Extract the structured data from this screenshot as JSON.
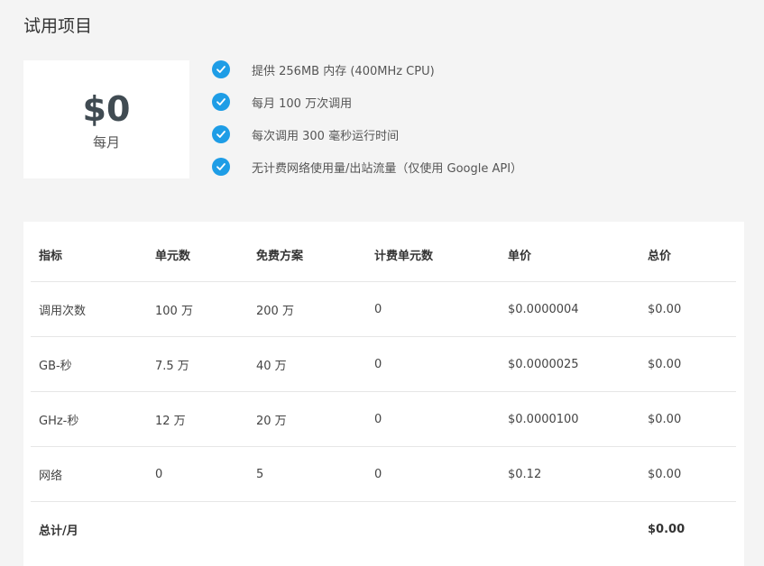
{
  "page": {
    "title": "试用项目"
  },
  "price_card": {
    "amount": "$0",
    "period": "每月"
  },
  "features": [
    {
      "text": "提供 256MB 内存 (400MHz CPU)",
      "icon": "check-circle-icon"
    },
    {
      "text": "每月 100 万次调用",
      "icon": "check-circle-icon"
    },
    {
      "text": "每次调用 300 毫秒运行时间",
      "icon": "check-circle-icon"
    },
    {
      "text": "无计费网络使用量/出站流量（仅使用 Google API）",
      "icon": "check-circle-icon"
    }
  ],
  "table": {
    "headers": [
      "指标",
      "单元数",
      "免费方案",
      "计费单元数",
      "单价",
      "总价"
    ],
    "rows": [
      [
        "调用次数",
        "100 万",
        "200 万",
        "0",
        "$0.0000004",
        "$0.00"
      ],
      [
        "GB-秒",
        "7.5 万",
        "40 万",
        "0",
        "$0.0000025",
        "$0.00"
      ],
      [
        "GHz-秒",
        "12 万",
        "20 万",
        "0",
        "$0.0000100",
        "$0.00"
      ],
      [
        "网络",
        "0",
        "5",
        "0",
        "$0.12",
        "$0.00"
      ]
    ],
    "total": {
      "label": "总计/月",
      "value": "$0.00"
    }
  },
  "colors": {
    "accent": "#1e9de6",
    "background": "#f4f4f4",
    "card": "#ffffff",
    "price": "#404b52"
  }
}
